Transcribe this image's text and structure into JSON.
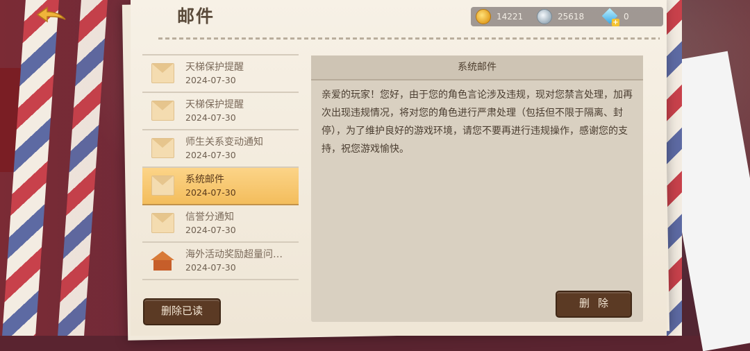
{
  "header": {
    "title": "邮件",
    "back_icon": "back-arrow-icon"
  },
  "currency": {
    "gold": "14221",
    "silver": "25618",
    "diamond": "0"
  },
  "mail_list": [
    {
      "subject": "天梯保护提醒",
      "date": "2024-07-30",
      "icon": "envelope-icon"
    },
    {
      "subject": "天梯保护提醒",
      "date": "2024-07-30",
      "icon": "envelope-icon"
    },
    {
      "subject": "师生关系变动通知",
      "date": "2024-07-30",
      "icon": "envelope-icon"
    },
    {
      "subject": "系统邮件",
      "date": "2024-07-30",
      "icon": "envelope-icon",
      "selected": true
    },
    {
      "subject": "信誉分通知",
      "date": "2024-07-30",
      "icon": "envelope-icon"
    },
    {
      "subject": "海外活动奖励超量问…",
      "date": "2024-07-30",
      "icon": "house-icon"
    }
  ],
  "buttons": {
    "delete_read": "删除已读",
    "delete": "删除"
  },
  "mail_detail": {
    "title": "系统邮件",
    "body": "亲爱的玩家！您好，由于您的角色言论涉及违规，现对您禁言处理，加再次出现违规情况，将对您的角色进行严肃处理（包括但不限于隔离、封停），为了维护良好的游戏环境，请您不要再进行违规操作，感谢您的支持，祝您游戏愉快。"
  },
  "colors": {
    "selected_row": "#f3bd5c",
    "button_bg": "#5b3a24",
    "paper": "#f1e9db"
  }
}
